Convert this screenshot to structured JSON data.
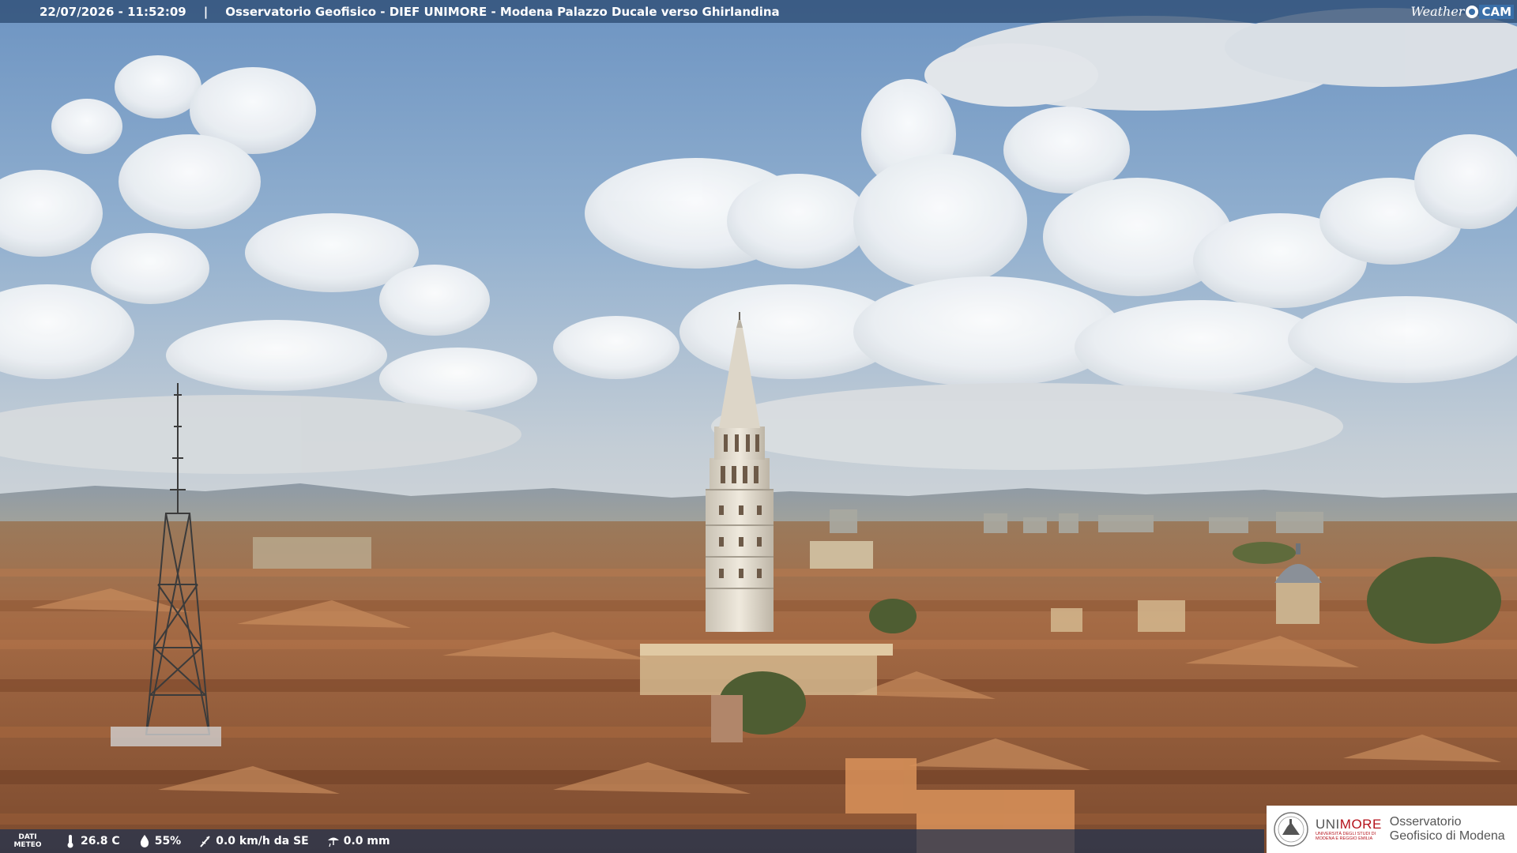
{
  "overlay": {
    "timestamp": "22/07/2026 - 11:52:09",
    "separator": "|",
    "caption": "Osservatorio Geofisico - DIEF UNIMORE - Modena Palazzo Ducale verso Ghirlandina"
  },
  "brand": {
    "weather": "Weather",
    "cam": "CAM"
  },
  "weather": {
    "label_line1": "DATI",
    "label_line2": "METEO",
    "temperature": "26.8 C",
    "humidity": "55%",
    "wind": "0.0 km/h da SE",
    "rain": "0.0 mm",
    "icons": {
      "temperature": "thermometer-icon",
      "humidity": "droplet-icon",
      "wind": "wind-icon",
      "rain": "rain-gauge-icon"
    }
  },
  "logo": {
    "uni_prefix": "UNI",
    "uni_suffix": "MORE",
    "uni_subtitle": "UNIVERSITÀ DEGLI STUDI DI MODENA E REGGIO EMILIA",
    "observatory": "Osservatorio Geofisico di Modena"
  },
  "colors": {
    "sky_top": "#6f97c4",
    "sky_bottom": "#c9d3da",
    "roofs": "#a5673f",
    "tower": "#e8e2d6",
    "overlay_bar": "#284670",
    "unimore_red": "#b5121b"
  }
}
